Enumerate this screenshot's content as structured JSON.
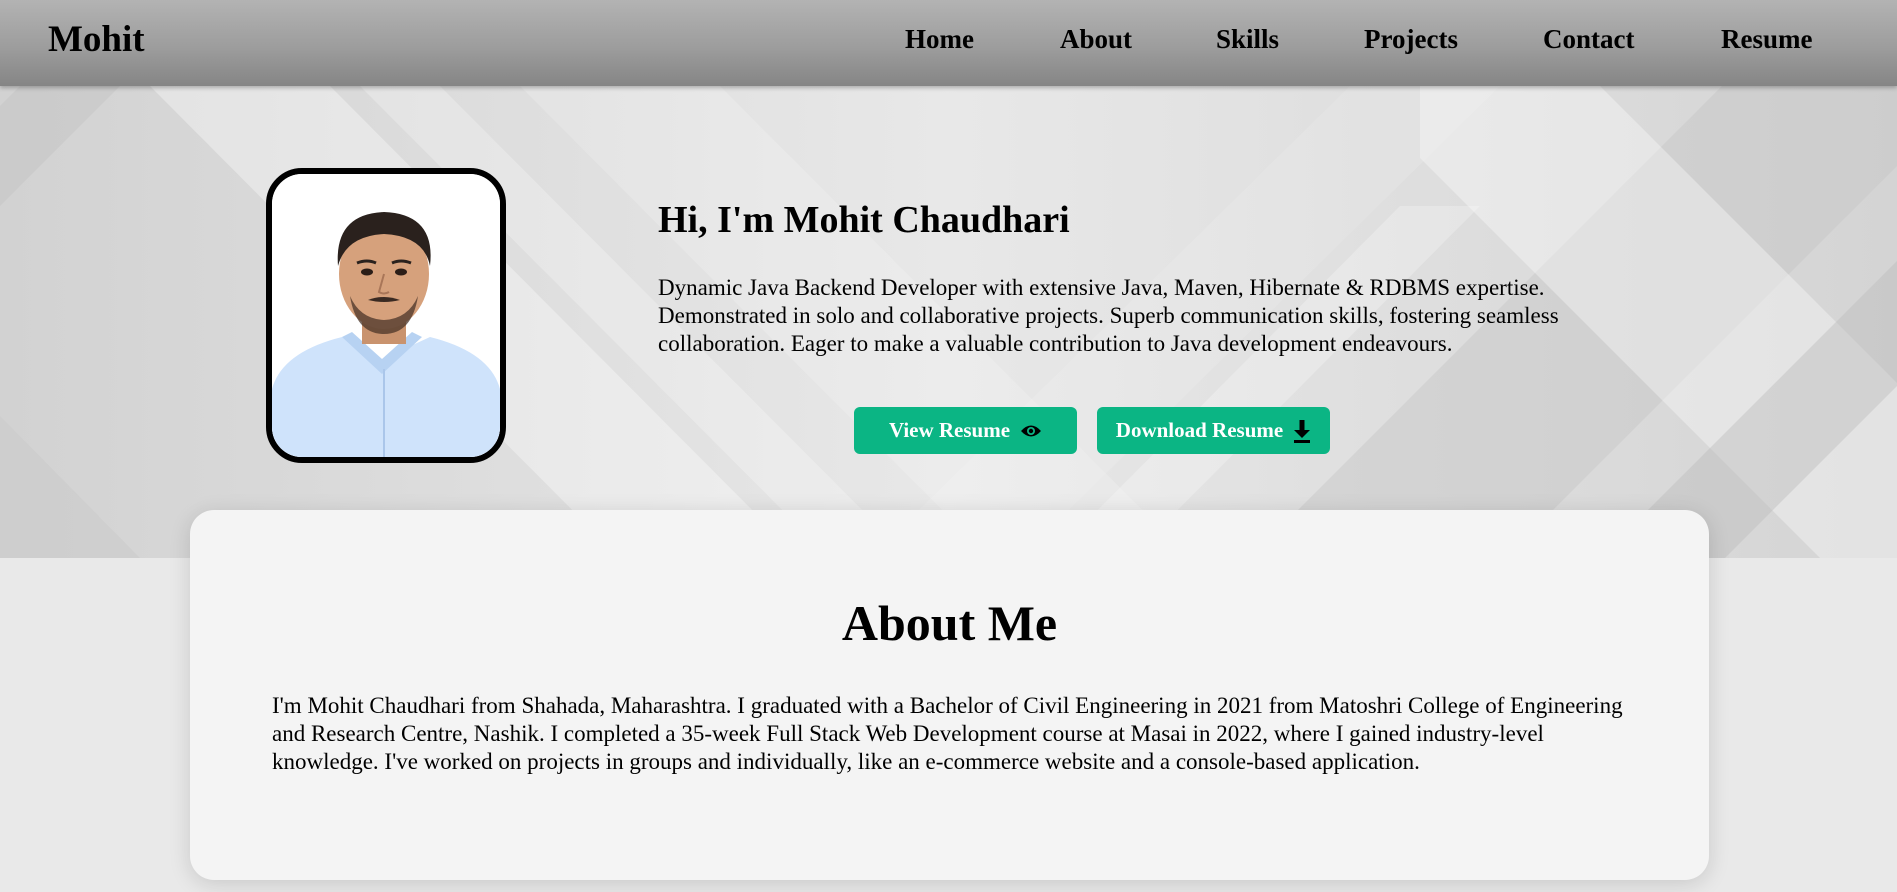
{
  "header": {
    "brand": "Mohit",
    "nav": [
      {
        "label": "Home"
      },
      {
        "label": "About"
      },
      {
        "label": "Skills"
      },
      {
        "label": "Projects"
      },
      {
        "label": "Contact"
      },
      {
        "label": "Resume"
      }
    ]
  },
  "hero": {
    "title": "Hi, I'm Mohit Chaudhari",
    "description": "Dynamic Java Backend Developer with extensive Java, Maven, Hibernate & RDBMS expertise. Demonstrated in solo and collaborative projects. Superb communication skills, fostering seamless collaboration. Eager to make a valuable contribution to Java development endeavours.",
    "buttons": {
      "view_resume": {
        "label": "View Resume",
        "icon": "eye-icon"
      },
      "download_resume": {
        "label": "Download Resume",
        "icon": "download-icon"
      }
    },
    "button_color": "#0bb584"
  },
  "about": {
    "title": "About Me",
    "text": "I'm Mohit Chaudhari from Shahada, Maharashtra. I graduated with a Bachelor of Civil Engineering in 2021 from Matoshri College of Engineering and Research Centre, Nashik. I completed a 35-week Full Stack Web Development course at Masai in 2022, where I gained industry-level knowledge. I've worked on projects in groups and individually, like an e-commerce website and a console-based application."
  }
}
